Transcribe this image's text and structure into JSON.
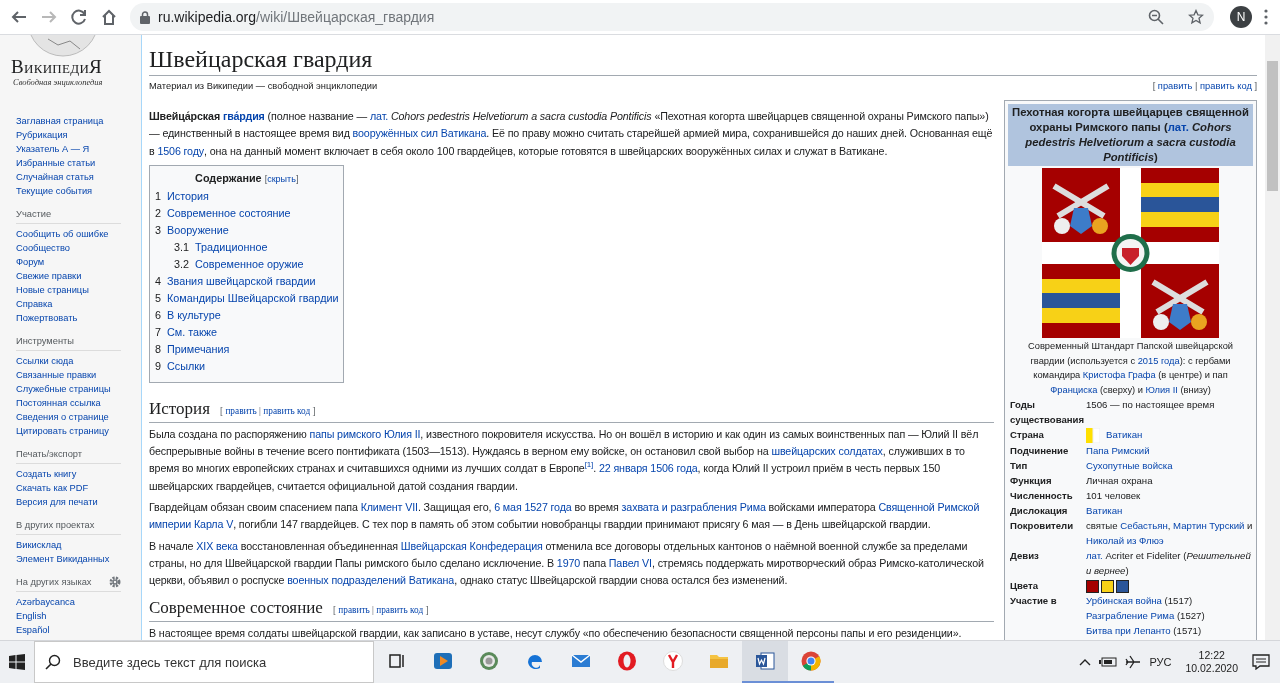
{
  "browser": {
    "nav_buttons": [
      {
        "kind": "back",
        "disabled": false
      },
      {
        "kind": "forward",
        "disabled": true
      },
      {
        "kind": "reload",
        "disabled": false
      },
      {
        "kind": "home",
        "disabled": false
      }
    ],
    "url": {
      "host": "ru.wikipedia.org",
      "path": "/wiki/Швейцарская_гвардия"
    },
    "avatar": "N"
  },
  "sidebar": {
    "logo": {
      "wordmark": "ВикипедиЯ",
      "tagline": "Свободная энциклопедия"
    },
    "nav": [
      "Заглавная страница",
      "Рубрикация",
      "Указатель А — Я",
      "Избранные статьи",
      "Случайная статья",
      "Текущие события"
    ],
    "sections": [
      {
        "heading": "Участие",
        "settings": false,
        "items": [
          "Сообщить об ошибке",
          "Сообщество",
          "Форум",
          "Свежие правки",
          "Новые страницы",
          "Справка",
          "Пожертвовать"
        ]
      },
      {
        "heading": "Инструменты",
        "settings": false,
        "items": [
          "Ссылки сюда",
          "Связанные правки",
          "Служебные страницы",
          "Постоянная ссылка",
          "Сведения о странице",
          "Цитировать страницу"
        ]
      },
      {
        "heading": "Печать/экспорт",
        "settings": false,
        "items": [
          "Создать книгу",
          "Скачать как PDF",
          "Версия для печати"
        ]
      },
      {
        "heading": "В других проектах",
        "settings": false,
        "items": [
          "Викисклад",
          "Элемент Викиданных"
        ]
      },
      {
        "heading": "На других языках",
        "settings": true,
        "items": [
          "Azərbaycanca",
          "English",
          "Español"
        ]
      }
    ]
  },
  "article": {
    "title": "Швейцарская гвардия",
    "subtitle": "Материал из Википедии — свободной энциклопедии",
    "edit": [
      {
        "text": "[ "
      },
      {
        "text": "править",
        "link": true
      },
      {
        "text": " | "
      },
      {
        "text": "править код",
        "link": true
      },
      {
        "text": " ]"
      }
    ],
    "lead": [
      [
        {
          "text": "**Швейца́рская** "
        },
        {
          "text": "**гва́рдия**",
          "link": true
        },
        {
          "text": " (полное название — "
        },
        {
          "text": "лат.",
          "link": true
        },
        {
          "text": " *Cohors pedestris Helvetiorum a sacra custodia Pontificis* «Пехотная когорта швейцарцев священной охраны Римского папы») — единственный в настоящее время вид "
        },
        {
          "text": "вооружённых сил Ватикана",
          "link": true
        },
        {
          "text": ". Её по праву можно считать старейшей армией мира, сохранившейся до наших дней. Основанная ещё в "
        },
        {
          "text": "1506 году",
          "link": true
        },
        {
          "text": ", она на данный момент включает в себя около 100 гвардейцев, которые готовятся в швейцарских вооружённых силах и служат в Ватикане."
        }
      ]
    ],
    "toc": {
      "title": "Содержание",
      "toggle": [
        {
          "text": "["
        },
        {
          "text": "скрыть",
          "link": true
        },
        {
          "text": "]"
        }
      ],
      "items": [
        {
          "number": "1",
          "label": "История"
        },
        {
          "number": "2",
          "label": "Современное состояние"
        },
        {
          "number": "3",
          "label": "Вооружение",
          "children": [
            {
              "number": "3.1",
              "label": "Традиционное"
            },
            {
              "number": "3.2",
              "label": "Современное оружие"
            }
          ]
        },
        {
          "number": "4",
          "label": "Звания швейцарской гвардии"
        },
        {
          "number": "5",
          "label": "Командиры Швейцарской гвардии"
        },
        {
          "number": "6",
          "label": "В культуре"
        },
        {
          "number": "7",
          "label": "См. также"
        },
        {
          "number": "8",
          "label": "Примечания"
        },
        {
          "number": "9",
          "label": "Ссылки"
        }
      ]
    },
    "sections": [
      {
        "heading": "История",
        "edit": [
          {
            "text": "[ "
          },
          {
            "text": "править",
            "link": true
          },
          {
            "text": " | "
          },
          {
            "text": "править код",
            "link": true
          },
          {
            "text": " ]"
          }
        ],
        "paragraphs": [
          [
            {
              "text": "Была создана по распоряжению "
            },
            {
              "text": "папы римского ",
              "link": true
            },
            {
              "text": "Юлия II",
              "link": true
            },
            {
              "text": ", известного покровителя искусства. Но он вошёл в историю и как один из самых воинственных пап — Юлий II вёл беспрерывные войны в течение всего понтификата (1503—1513). Нуждаясь в верном ему войске, он остановил свой выбор на "
            },
            {
              "text": "швейцарских солдатах",
              "link": true
            },
            {
              "text": ", служивших в то время во многих европейских странах и считавшихся одними из лучших солдат в Европе"
            },
            {
              "text": "$^{[1]}$",
              "link": true
            },
            {
              "text": ". "
            },
            {
              "text": "22 января 1506 года",
              "link": true
            },
            {
              "text": ", когда Юлий II устроил приём в честь первых 150 швейцарских гвардейцев, считается официальной датой создания гвардии."
            }
          ],
          [
            {
              "text": "Гвардейцам обязан своим спасением папа "
            },
            {
              "text": "Климент VII",
              "link": true
            },
            {
              "text": ". Защищая его, "
            },
            {
              "text": "6 мая 1527 года",
              "link": true
            },
            {
              "text": " во время "
            },
            {
              "text": "захвата и разграбления Рима",
              "link": true
            },
            {
              "text": " войсками императора "
            },
            {
              "text": "Священной Римской ",
              "link": true
            },
            {
              "text": "империи ",
              "link": true
            },
            {
              "text": "Карла V",
              "link": true
            },
            {
              "text": ", погибли 147 гвардейцев. С тех пор в память об этом событии новобранцы гвардии принимают присягу 6 мая — в День швейцарской гвардии."
            }
          ],
          [
            {
              "text": "В начале "
            },
            {
              "text": "XIX века",
              "link": true
            },
            {
              "text": " восстановленная объединенная "
            },
            {
              "text": "Швейцарская Конфедерация",
              "link": true
            },
            {
              "text": " отменила все договоры отдельных кантонов о наёмной военной службе за пределами страны, но для Швейцарской гвардии Папы римского было сделано исключение. В "
            },
            {
              "text": "1970",
              "link": true
            },
            {
              "text": " папа "
            },
            {
              "text": "Павел VI",
              "link": true
            },
            {
              "text": ", стремясь поддержать миротворческий образ Римско-католической церкви, объявил о роспуске "
            },
            {
              "text": "военных подразделений Ватикана",
              "link": true
            },
            {
              "text": ", однако статус Швейцарской гвардии снова остался без изменений."
            }
          ]
        ]
      },
      {
        "heading": "Современное состояние",
        "edit": [
          {
            "text": "[ "
          },
          {
            "text": "править",
            "link": true
          },
          {
            "text": " | "
          },
          {
            "text": "править код",
            "link": true
          },
          {
            "text": " ]"
          }
        ],
        "paragraphs": [
          [
            {
              "text": "В настоящее время солдаты швейцарской гвардии, как записано в уставе, несут службу «по обеспечению безопасности священной персоны папы и его резиденции»."
            }
          ]
        ]
      }
    ]
  },
  "infobox": {
    "header": [
      {
        "text": "Пехотная когорта швейцарцев священной охраны Римского папы ("
      },
      {
        "text": "лат.",
        "link": true
      },
      {
        "text": " *Cohors pedestris Helvetiorum a sacra custodia Pontificis*)"
      }
    ],
    "caption": [
      {
        "text": "Современный Штандарт Папской швейцарской гвардии (используется с "
      },
      {
        "text": "2015 года",
        "link": true
      },
      {
        "text": "): с гербами командира "
      },
      {
        "text": "Кристофа Графа",
        "link": true
      },
      {
        "text": " (в центре) и пап "
      },
      {
        "text": "Франциска",
        "link": true
      },
      {
        "text": " (сверху) и "
      },
      {
        "text": "Юлия II",
        "link": true
      },
      {
        "text": " (внизу)"
      }
    ],
    "rows": [
      {
        "kind": "text",
        "label": "Годы существования",
        "lines": [
          [
            {
              "text": "1506 — по настоящее время"
            }
          ]
        ]
      },
      {
        "kind": "country",
        "label": "Страна",
        "lines": [
          [
            {
              "text": "Ватикан",
              "link": true
            }
          ]
        ]
      },
      {
        "kind": "text",
        "label": "Подчинение",
        "lines": [
          [
            {
              "text": "Папа Римский",
              "link": true
            }
          ]
        ]
      },
      {
        "kind": "text",
        "label": "Тип",
        "lines": [
          [
            {
              "text": "Сухопутные войска",
              "link": true
            }
          ]
        ]
      },
      {
        "kind": "text",
        "label": "Функция",
        "lines": [
          [
            {
              "text": "Личная охрана"
            }
          ]
        ]
      },
      {
        "kind": "text",
        "label": "Численность",
        "lines": [
          [
            {
              "text": "101 человек"
            }
          ]
        ]
      },
      {
        "kind": "text",
        "label": "Дислокация",
        "lines": [
          [
            {
              "text": "Ватикан",
              "link": true
            }
          ]
        ]
      },
      {
        "kind": "text",
        "label": "Покровители",
        "lines": [
          [
            {
              "text": "святые "
            },
            {
              "text": "Себастьян",
              "link": true
            },
            {
              "text": ", "
            },
            {
              "text": "Мартин Турский",
              "link": true
            },
            {
              "text": " и "
            },
            {
              "text": "Николай из Флюэ",
              "link": true
            }
          ]
        ]
      },
      {
        "kind": "text",
        "label": "Девиз",
        "lines": [
          [
            {
              "text": "лат.",
              "link": true
            },
            {
              "text": " Acriter et Fideliter (*Решительней и вернее*)"
            }
          ]
        ]
      },
      {
        "kind": "colors",
        "label": "Цвета",
        "swatches": [
          {
            "color": "#a50000"
          },
          {
            "color": "#f7d117"
          },
          {
            "color": "#2a5599"
          }
        ]
      },
      {
        "kind": "text",
        "label": "Участие в",
        "lines": [
          [
            {
              "text": "Урбинская война",
              "link": true
            },
            {
              "text": " (1517)"
            }
          ],
          [
            {
              "text": "Разграбление Рима",
              "link": true
            },
            {
              "text": " (1527)"
            }
          ],
          [
            {
              "text": "Битва при Лепанто",
              "link": true
            },
            {
              "text": " (1571)"
            }
          ]
        ]
      }
    ]
  },
  "taskbar": {
    "search_placeholder": "Введите здесь текст для поиска",
    "apps": [
      {
        "kind": "taskview",
        "open": false,
        "selected": false
      },
      {
        "kind": "media",
        "open": false,
        "selected": false
      },
      {
        "kind": "ring",
        "open": false,
        "selected": false
      },
      {
        "kind": "edge",
        "open": false,
        "selected": false
      },
      {
        "kind": "mail",
        "open": false,
        "selected": false
      },
      {
        "kind": "opera",
        "open": false,
        "selected": false
      },
      {
        "kind": "yandex",
        "open": false,
        "selected": false
      },
      {
        "kind": "folder",
        "open": false,
        "selected": false
      },
      {
        "kind": "word",
        "open": true,
        "selected": true
      },
      {
        "kind": "chrome",
        "open": true,
        "selected": false
      }
    ],
    "language": "РУС",
    "time": "12:22",
    "date": "10.02.2020"
  }
}
